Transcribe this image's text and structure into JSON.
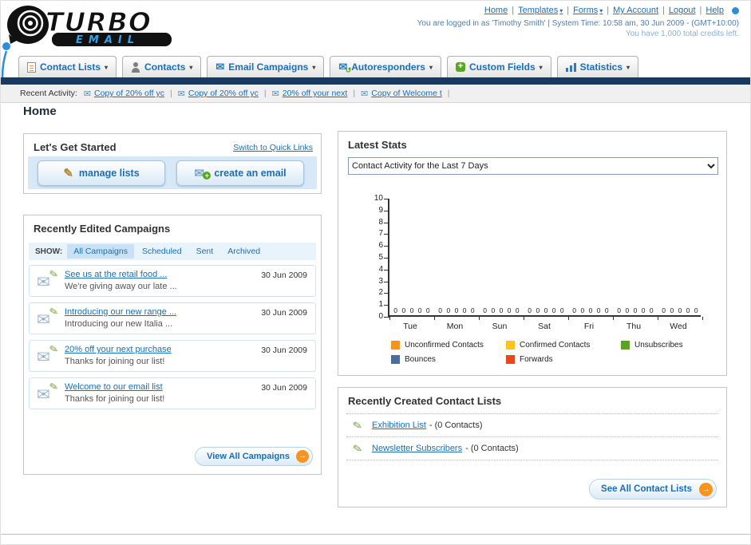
{
  "header": {
    "logo": {
      "title": "TURBO",
      "subtitle": "EMAIL"
    },
    "nav_links": [
      {
        "label": "Home",
        "dropdown": false
      },
      {
        "label": "Templates",
        "dropdown": true
      },
      {
        "label": "Forms",
        "dropdown": true
      },
      {
        "label": "My Account",
        "dropdown": false
      },
      {
        "label": "Logout",
        "dropdown": false
      },
      {
        "label": "Help",
        "dropdown": false
      }
    ],
    "login_info": "You are logged in as 'Timothy Smith' | System Time: 10:58 am, 30 Jun 2009 - (GMT+10:00)",
    "credits_info": "You have 1,000 total credits left."
  },
  "main_nav": {
    "tabs": [
      {
        "label": "Contact Lists",
        "icon": "contact-lists-icon"
      },
      {
        "label": "Contacts",
        "icon": "contacts-icon"
      },
      {
        "label": "Email Campaigns",
        "icon": "email-campaigns-icon"
      },
      {
        "label": "Autoresponders",
        "icon": "autoresponders-icon"
      },
      {
        "label": "Custom Fields",
        "icon": "custom-fields-icon"
      },
      {
        "label": "Statistics",
        "icon": "statistics-icon"
      }
    ]
  },
  "recent_activity": {
    "label": "Recent Activity:",
    "items": [
      "Copy of 20% off yc",
      "Copy of 20% off yc",
      "20% off your next",
      "Copy of Welcome t"
    ]
  },
  "page": {
    "title": "Home"
  },
  "getting_started": {
    "title": "Let's Get Started",
    "switch_link": "Switch to Quick Links",
    "buttons": [
      {
        "label": "manage lists",
        "icon": "pencil-icon"
      },
      {
        "label": "create an email",
        "icon": "envelope-plus-icon"
      }
    ]
  },
  "campaigns": {
    "title": "Recently Edited Campaigns",
    "show_label": "SHOW:",
    "filters": [
      "All Campaigns",
      "Scheduled",
      "Sent",
      "Archived"
    ],
    "active_filter": "All Campaigns",
    "items": [
      {
        "title": "See us at the retail food ...",
        "subtitle": "We're giving away our late ...",
        "date": "30 Jun 2009"
      },
      {
        "title": "Introducing our new range ...",
        "subtitle": "Introducing our new Italia ...",
        "date": "30 Jun 2009"
      },
      {
        "title": "20% off your next purchase",
        "subtitle": "Thanks for joining our list!",
        "date": "30 Jun 2009"
      },
      {
        "title": "Welcome to our email list",
        "subtitle": "Thanks for joining our list!",
        "date": "30 Jun 2009"
      }
    ],
    "view_all_label": "View All Campaigns"
  },
  "stats": {
    "title": "Latest Stats",
    "range_selected": "Contact Activity for the Last 7 Days"
  },
  "chart_data": {
    "type": "bar",
    "title": "Contact Activity for the Last 7 Days",
    "categories": [
      "Tue",
      "Mon",
      "Sun",
      "Sat",
      "Fri",
      "Thu",
      "Wed"
    ],
    "series": [
      {
        "name": "Unconfirmed Contacts",
        "color": "#f7941d",
        "values": [
          0,
          0,
          0,
          0,
          0,
          0,
          0
        ]
      },
      {
        "name": "Confirmed Contacts",
        "color": "#fdc616",
        "values": [
          0,
          0,
          0,
          0,
          0,
          0,
          0
        ]
      },
      {
        "name": "Unsubscribes",
        "color": "#5aa31e",
        "values": [
          0,
          0,
          0,
          0,
          0,
          0,
          0
        ]
      },
      {
        "name": "Bounces",
        "color": "#4a6d9d",
        "values": [
          0,
          0,
          0,
          0,
          0,
          0,
          0
        ]
      },
      {
        "name": "Forwards",
        "color": "#e6471d",
        "values": [
          0,
          0,
          0,
          0,
          0,
          0,
          0
        ]
      }
    ],
    "ylim": [
      0,
      10
    ],
    "yticks": [
      0,
      1,
      2,
      3,
      4,
      5,
      6,
      7,
      8,
      9,
      10
    ],
    "grid": false,
    "legend_position": "bottom"
  },
  "contact_lists": {
    "title": "Recently Created Contact Lists",
    "items": [
      {
        "name": "Exhibition List",
        "detail": "- (0 Contacts)"
      },
      {
        "name": "Newsletter Subscribers",
        "detail": "- (0 Contacts)"
      }
    ],
    "see_all_label": "See All Contact Lists"
  }
}
